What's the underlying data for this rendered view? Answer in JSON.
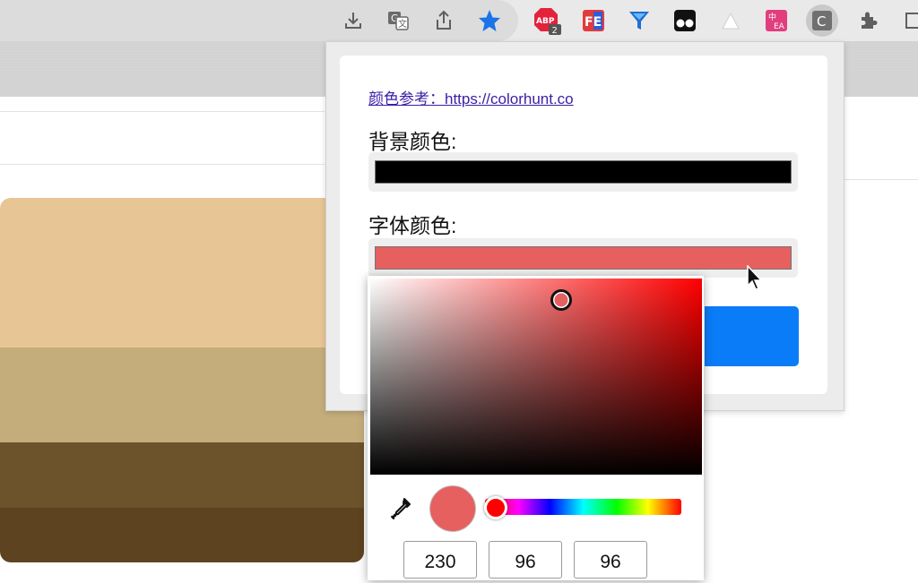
{
  "toolbar": {
    "extensions": [
      {
        "icon": "download-icon"
      },
      {
        "icon": "translate-icon"
      },
      {
        "icon": "share-icon"
      },
      {
        "icon": "bookmark-star-icon"
      },
      {
        "icon": "adblock-plus-icon",
        "badge": "2"
      },
      {
        "icon": "fe-helper-icon",
        "label": "FE"
      },
      {
        "icon": "funnel-icon"
      },
      {
        "icon": "tampermonkey-icon"
      },
      {
        "icon": "triangle-icon"
      },
      {
        "icon": "translator-icon",
        "label": "中\nEA"
      },
      {
        "icon": "color-ext-icon",
        "label": "C"
      },
      {
        "icon": "puzzle-icon"
      }
    ]
  },
  "popup": {
    "ref_link": "颜色参考：https://colorhunt.co",
    "bg_label": "背景颜色:",
    "bg_color": "#000000",
    "font_label": "字体颜色:",
    "font_color": "#e66060",
    "action_color": "#0b7cf8"
  },
  "picker": {
    "hue_color": "#ff0000",
    "current_color": "#e66060",
    "hue_fraction": 0.0,
    "rgb": {
      "r": "230",
      "g": "96",
      "b": "96"
    }
  },
  "palette": {
    "colors": [
      "#e8c594",
      "#c4ad7b",
      "#6c532b",
      "#5e4320"
    ]
  }
}
